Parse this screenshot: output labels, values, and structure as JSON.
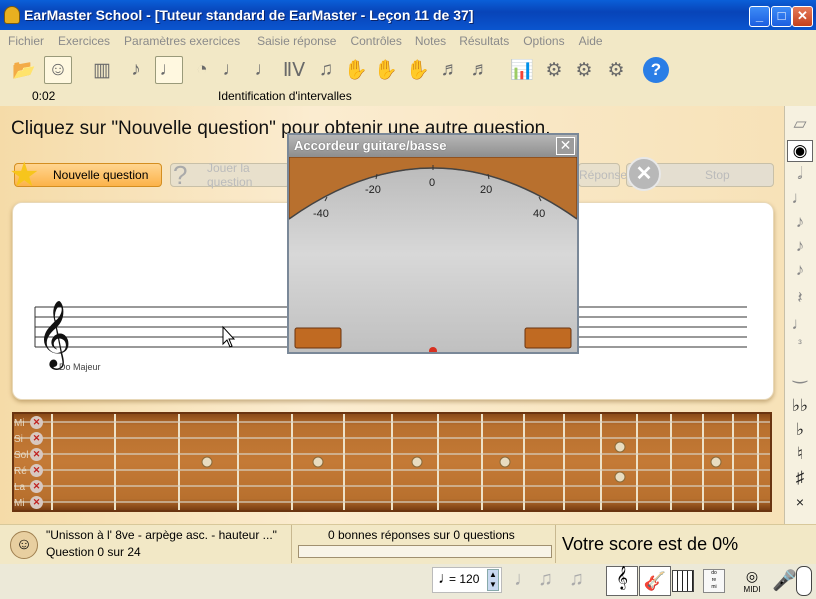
{
  "window": {
    "title": "EarMaster School - [Tuteur standard de EarMaster - Leçon 11 de 37]",
    "minimize": "_",
    "maximize": "□",
    "close": "✕"
  },
  "menu": [
    "Fichier",
    "Exercices",
    "Paramètres exercices",
    "Saisie réponse",
    "Contrôles",
    "Notes",
    "Résultats",
    "Options",
    "Aide"
  ],
  "status": {
    "time": "0:02",
    "exercise": "Identification d'intervalles"
  },
  "instruction": "Cliquez sur \"Nouvelle question\" pour obtenir une autre question.",
  "buttons": {
    "new_question": "Nouvelle question",
    "play_question": "Jouer la question",
    "answer": "Réponse",
    "stop": "Stop"
  },
  "staff": {
    "key_label": "Do Majeur"
  },
  "fretboard": {
    "strings": [
      "Mi",
      "Si",
      "Sol",
      "Ré",
      "La",
      "Mi"
    ],
    "x_mark": "✕"
  },
  "tuner": {
    "title": "Accordeur guitare/basse",
    "close": "✕",
    "scale": [
      "-40",
      "-20",
      "0",
      "20",
      "40"
    ]
  },
  "bottom": {
    "lesson_desc": "\"Unisson à l' 8ve - arpège asc. - hauteur ...\"",
    "question_count": "Question 0 sur 24",
    "correct": "0 bonnes réponses sur 0 questions",
    "score": "Votre score est de 0%"
  },
  "footer": {
    "tempo_eq": "= 120",
    "midi": "MIDI"
  },
  "colors": {
    "title_blue": "#0a5fd8",
    "cream": "#f7e2b8",
    "wood": "#c47a36",
    "button_orange": "#fcb34a"
  }
}
